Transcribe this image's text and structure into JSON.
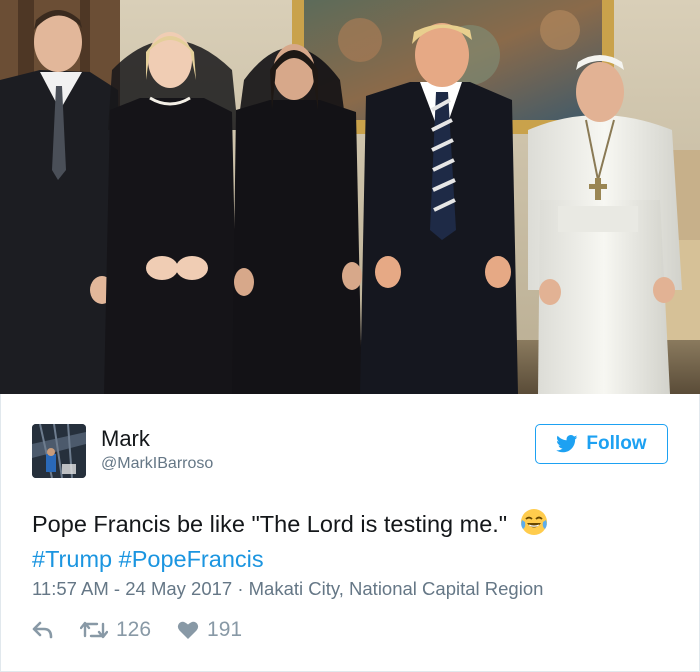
{
  "tweet": {
    "user": {
      "name": "Mark",
      "handle": "@MarkIBarroso"
    },
    "follow_label": "Follow",
    "text": "Pope Francis be like \"The Lord is testing me.\"",
    "emoji": "face-with-tears-of-joy",
    "hashtags": [
      "#Trump",
      "#PopeFrancis"
    ],
    "meta": "11:57 AM - 24 May 2017 · Makati City, National Capital Region",
    "retweets": "126",
    "likes": "191"
  },
  "icons": {
    "follow": "twitter-bird-icon",
    "reply": "reply-icon",
    "retweet": "retweet-icon",
    "like": "heart-icon"
  },
  "colors": {
    "accent": "#1da1f2",
    "hashtag": "#1b95e0",
    "secondary_text": "#657786",
    "action_icons": "#8899a6"
  }
}
